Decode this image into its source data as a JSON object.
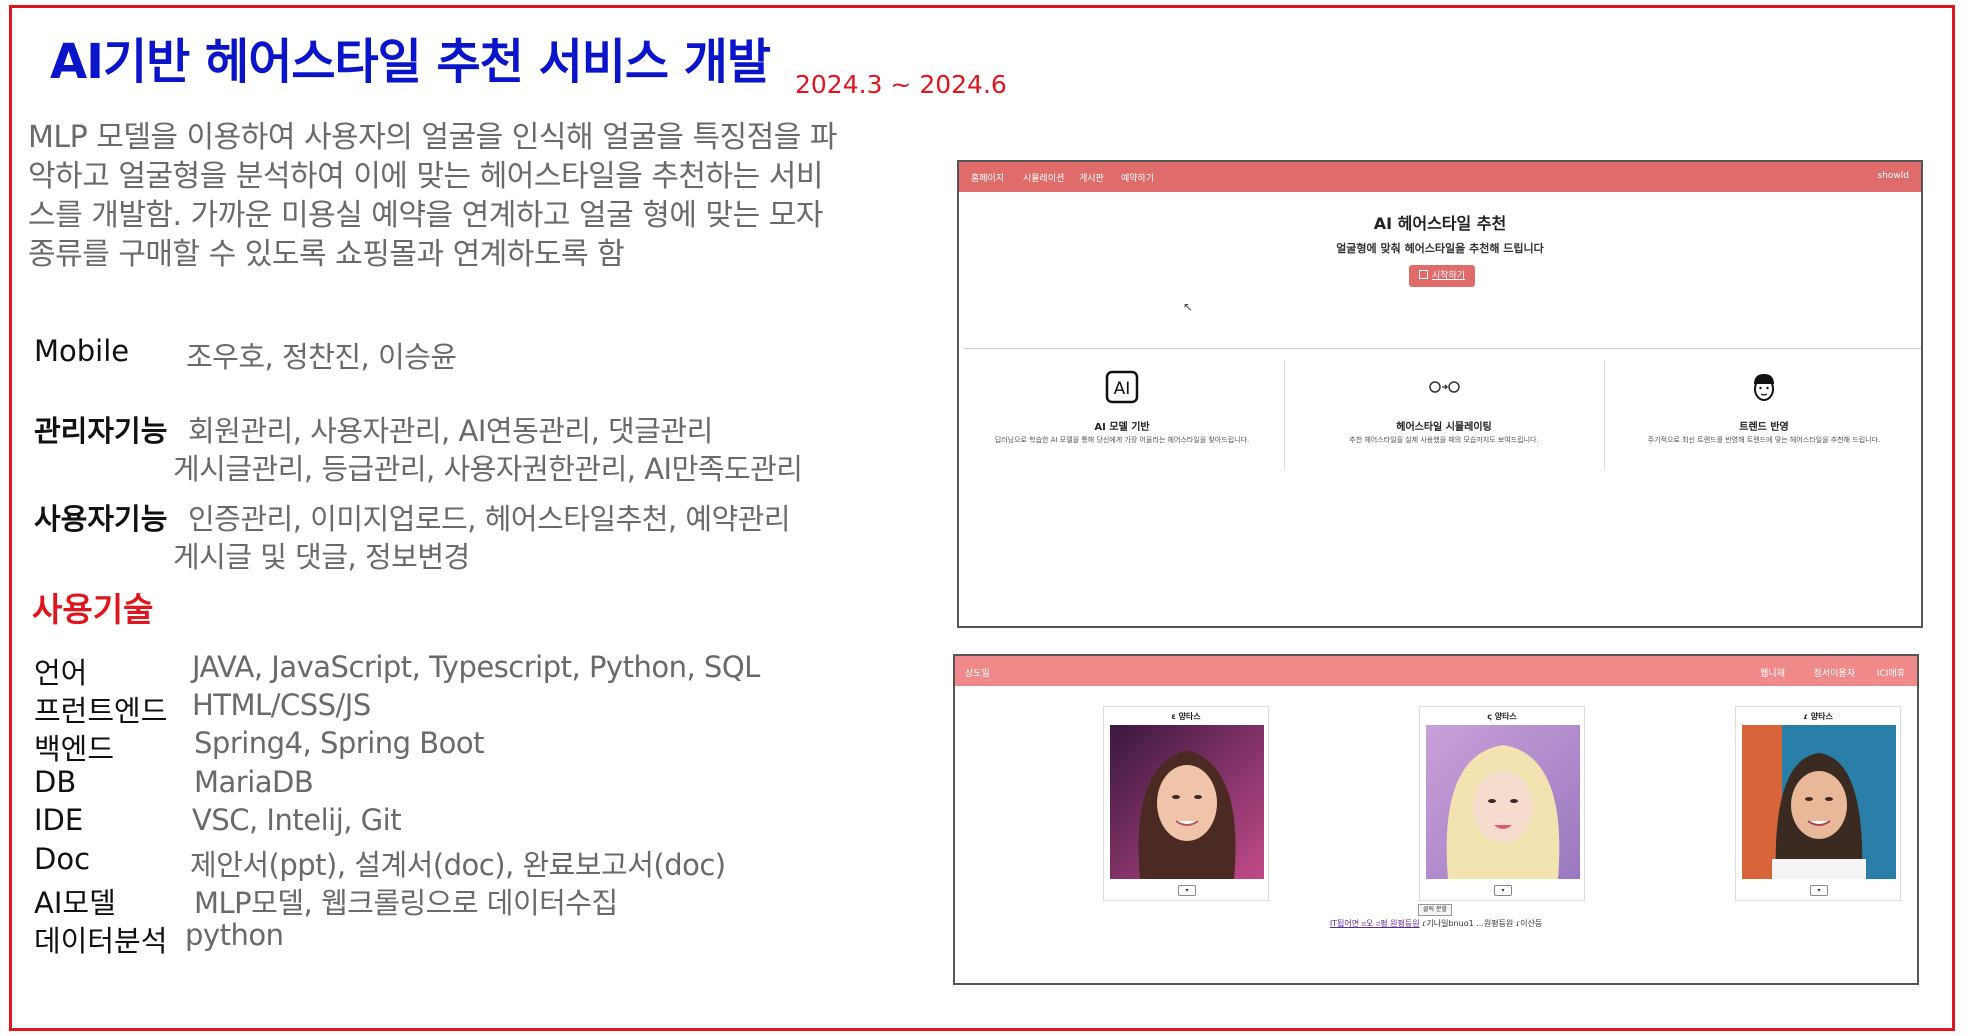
{
  "title": "AI기반 헤어스타일 추천 서비스 개발",
  "period": "2024.3 ~ 2024.6",
  "description": "MLP 모델을 이용하여 사용자의 얼굴을 인식해 얼굴을 특징점을 파악하고 얼굴형을 분석하여 이에 맞는 헤어스타일을 추천하는 서비스를 개발함. 가까운 미용실 예약을 연계하고 얼굴 형에 맞는 모자 종류를 구매할 수 있도록 쇼핑몰과 연계하도록 함",
  "team": {
    "label": "Mobile",
    "value": "조우호, 정찬진, 이승윤"
  },
  "admin": {
    "label": "관리자기능",
    "line1": "회원관리, 사용자관리, AI연동관리, 댓글관리",
    "line2": "게시글관리, 등급관리,  사용자권한관리, AI만족도관리"
  },
  "user": {
    "label": "사용자기능",
    "line1": "인증관리, 이미지업로드, 헤어스타일추천, 예약관리",
    "line2": "게시글 및 댓글, 정보변경"
  },
  "tech_heading": "사용기술",
  "tech": [
    {
      "label": "언어",
      "value": "JAVA, JavaScript, Typescript, Python, SQL"
    },
    {
      "label": "프런트엔드",
      "value": "HTML/CSS/JS"
    },
    {
      "label": "백엔드",
      "value": "Spring4, Spring Boot"
    },
    {
      "label": "DB",
      "value": "MariaDB"
    },
    {
      "label": "IDE",
      "value": "VSC, Intelij, Git"
    },
    {
      "label": "Doc",
      "value": "제안서(ppt), 설계서(doc), 완료보고서(doc)"
    },
    {
      "label": "AI모델",
      "value": "MLP모델, 웹크롤링으로 데이터수집"
    },
    {
      "label": "데이터분석",
      "value": "python"
    }
  ],
  "shot1": {
    "nav": [
      "홈페이지",
      "시뮬레이션",
      "게시판",
      "예약하기"
    ],
    "nav_right": "showld",
    "heading": "AI 헤어스타일 추천",
    "subheading": "얼굴형에 맞춰 헤어스타일을 추천해 드립니다",
    "start_button": "시작하기",
    "features": [
      {
        "title": "AI 모델 기반",
        "desc": "딥러닝으로 학습한 AI 모델을 통해 당신에게 가장 어울리는 헤어스타일을 찾아드립니다."
      },
      {
        "title": "헤어스타일 시뮬레이팅",
        "desc": "추천 헤어스타일을 실제 사용했을 때의 모습까지도 보여드립니다."
      },
      {
        "title": "트렌드 반영",
        "desc": "주기적으로 최신 트렌드를 반영해 트렌드에 맞는 헤어스타일을 추천해 드립니다."
      }
    ]
  },
  "shot2": {
    "logo": "상도일",
    "nav_right": [
      "웹니재",
      "정서이용자",
      "ICI애휴"
    ],
    "cards": [
      {
        "label": "ε 양타스",
        "colors": [
          "#5b2a5e",
          "#c24a8a",
          "#f0c4a8"
        ]
      },
      {
        "label": "ς 양타스",
        "colors": [
          "#b58ac8",
          "#f3e3b0",
          "#f3d4c4"
        ]
      },
      {
        "label": "ɾ 양타스",
        "colors": [
          "#2a7fa8",
          "#d8643a",
          "#e8b898"
        ]
      }
    ],
    "tooltip": "클릭 분할",
    "footer_link": "IT됩어면 ಠ오 ನ평 원평등원",
    "footer_text": "ɾ기나일bnuo1 ...원평등원 ɾ이산등"
  },
  "colors": {
    "accent_red": "#e0161e",
    "title_blue": "#0a14c8",
    "nav_pink": "#e06b6b"
  }
}
